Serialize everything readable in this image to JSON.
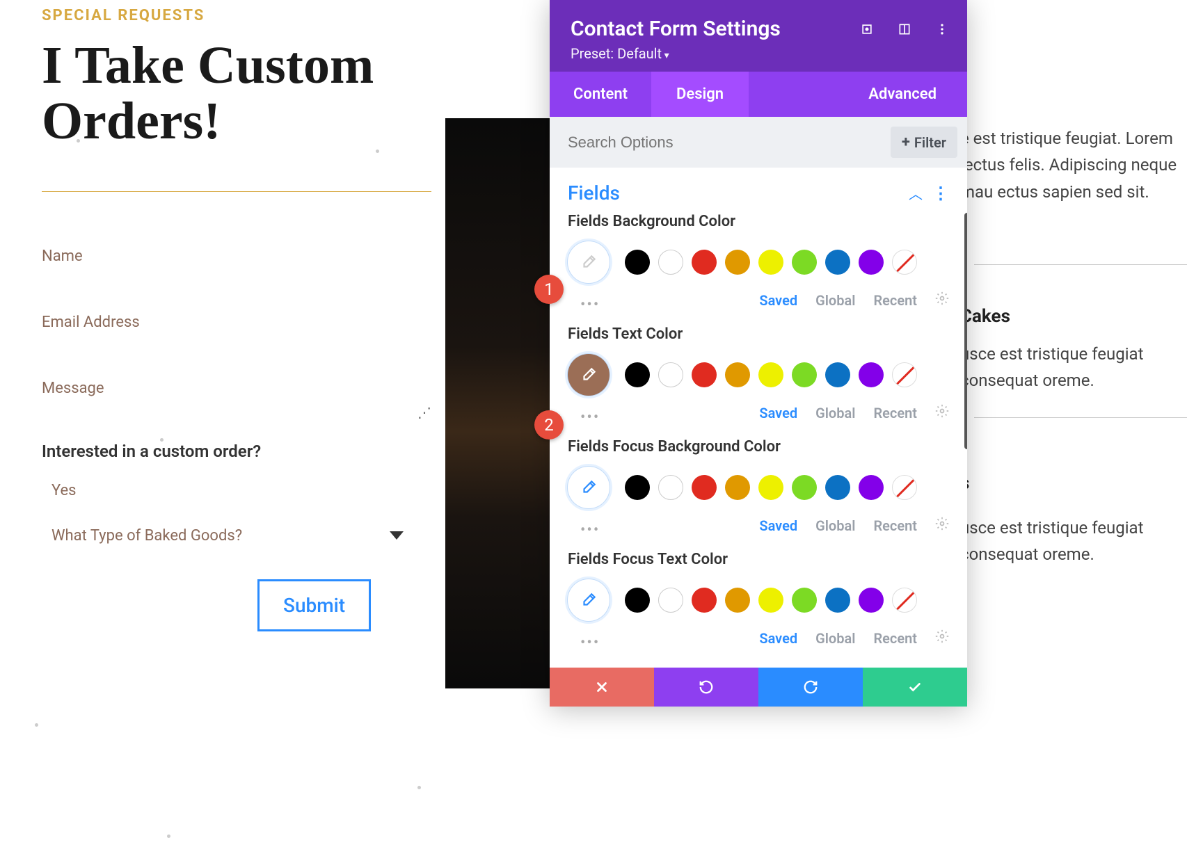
{
  "page": {
    "eyebrow": "SPECIAL REQUESTS",
    "headline": "I Take Custom Orders!",
    "fields": {
      "name": "Name",
      "email": "Email Address",
      "message": "Message"
    },
    "question1": "Interested in a custom order?",
    "answer1": "Yes",
    "question2": "What Type of Baked Goods?",
    "submit": "Submit"
  },
  "rightText": {
    "block1": "e est tristique feugiat. Lorem lectus felis. Adipiscing neque mau ectus sapien sed sit.",
    "head1": "Cakes",
    "block2": "usce est tristique feugiat consequat oreme.",
    "head2": "s",
    "block3": "usce est tristique feugiat consequat oreme."
  },
  "panel": {
    "title": "Contact Form Settings",
    "preset": "Preset: Default",
    "tabs": [
      "Content",
      "Design",
      "Advanced"
    ],
    "activeTab": 1,
    "searchPlaceholder": "Search Options",
    "filterLabel": "Filter",
    "section": "Fields",
    "fieldGroups": [
      {
        "label": "Fields Background Color",
        "pickerStyle": "white",
        "dropColor": "#ccc"
      },
      {
        "label": "Fields Text Color",
        "pickerStyle": "brown",
        "dropColor": "#fff"
      },
      {
        "label": "Fields Focus Background Color",
        "pickerStyle": "white",
        "dropColor": "#2a8cff"
      },
      {
        "label": "Fields Focus Text Color",
        "pickerStyle": "white",
        "dropColor": "#2a8cff"
      }
    ],
    "swatchFoot": {
      "saved": "Saved",
      "global": "Global",
      "recent": "Recent"
    }
  },
  "steps": {
    "s1": "1",
    "s2": "2"
  }
}
